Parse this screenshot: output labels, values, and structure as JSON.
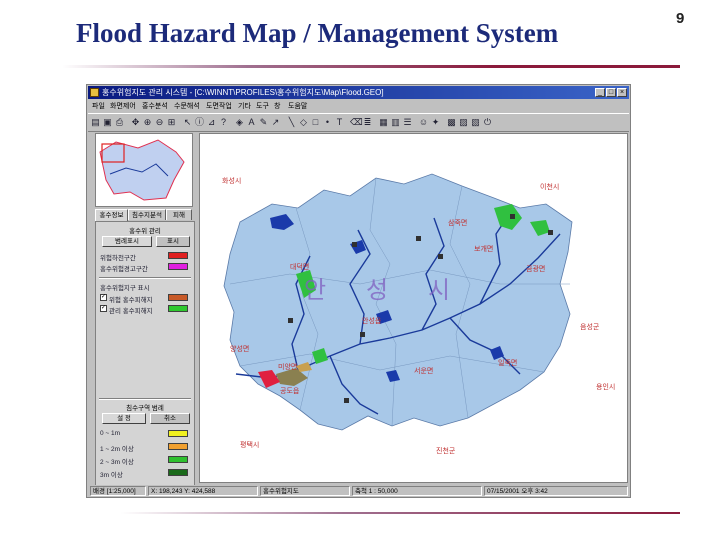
{
  "slide": {
    "title": "Flood Hazard Map / Management System",
    "page_number": "9"
  },
  "window": {
    "title": "홍수위험지도 관리 시스템 - [C:\\WINNT\\PROFILES\\홍수위험지도\\Map\\Flood.GEO]",
    "controls": [
      "_",
      "□",
      "×"
    ]
  },
  "menu": [
    "파일",
    "화면제어",
    "홍수분석",
    "수문해석",
    "도면작업",
    "기타",
    "도구",
    "창",
    "도움말"
  ],
  "toolbar_icons": [
    "open-file",
    "save",
    "print",
    "pan",
    "zoom-in",
    "zoom-out",
    "full-extent",
    "select",
    "identify",
    "measure",
    "query",
    "layer",
    "label",
    "line",
    "polygon",
    "point",
    "text",
    "erase",
    "legend",
    "table",
    "chart",
    "report",
    "help",
    "exit"
  ],
  "panel": {
    "tabs": [
      "홍수정보",
      "침수지분석",
      "피해"
    ],
    "active_tab": "홍수정보",
    "section1": {
      "heading": "홍수위 관리",
      "buttons": [
        "범례표시",
        "표시"
      ],
      "rows": [
        {
          "label": "위험하천구간",
          "color": "#e02020"
        },
        {
          "label": "홍수위험경고구간",
          "color": "#e020e0"
        }
      ],
      "legend_heading": "홍수위험지구 표시",
      "checks": [
        {
          "label": "위험 홍수피해지",
          "color": "#c85a28",
          "checked": true
        },
        {
          "label": "관리 홍수피해지",
          "color": "#2ec82e",
          "checked": true
        }
      ]
    },
    "section2": {
      "heading": "침수구역 범례",
      "buttons": [
        "설 정",
        "취소"
      ],
      "rows": [
        {
          "label": "0 ~ 1m",
          "color": "#f0f020"
        },
        {
          "label": "1 ~ 2m 이상",
          "color": "#f0a030"
        },
        {
          "label": "2 ~ 3m 이상",
          "color": "#30c030"
        },
        {
          "label": "3m 이상",
          "color": "#1a6a1a"
        }
      ]
    }
  },
  "map": {
    "region_name": "안 성 시",
    "labels": [
      "화성시",
      "이천시",
      "용인시",
      "평택시",
      "진천군",
      "음성군",
      "양성면",
      "대덕면",
      "미양면",
      "공도읍",
      "안성읍",
      "보개면",
      "금광면",
      "삼죽면",
      "일죽면",
      "서운면"
    ],
    "colors": {
      "land": "#a8c8e8",
      "river": "#1a3a9a",
      "flood_zone": "#30c040",
      "danger": "#e02040",
      "region_name": "#8060c0"
    }
  },
  "status": [
    "배경 [1:25,000]",
    "X: 198,243 Y: 424,588",
    "홍수위험지도",
    "축척 1 : 50,000",
    "07/15/2001 오후 3:42"
  ]
}
